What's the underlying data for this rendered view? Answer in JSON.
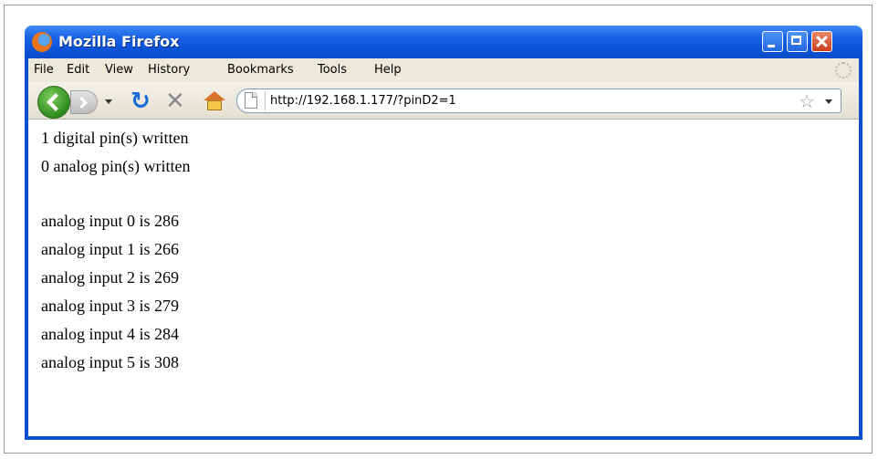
{
  "window": {
    "title": "Mozilla Firefox"
  },
  "menubar": {
    "items": [
      {
        "label": "File"
      },
      {
        "label": "Edit"
      },
      {
        "label": "View"
      },
      {
        "label": "History"
      },
      {
        "label": "Bookmarks"
      },
      {
        "label": "Tools"
      },
      {
        "label": "Help"
      }
    ]
  },
  "navbar": {
    "url": "http://192.168.1.177/?pinD2=1",
    "icons": [
      "back-icon",
      "forward-icon",
      "reload-icon",
      "stop-icon",
      "home-icon",
      "page-icon",
      "bookmark-star-icon"
    ]
  },
  "page": {
    "lines": [
      "1 digital pin(s) written",
      "0 analog pin(s) written",
      "analog input 0 is 286",
      "analog input 1 is 266",
      "analog input 2 is 269",
      "analog input 3 is 279",
      "analog input 4 is 284",
      "analog input 5 is 308"
    ]
  },
  "colors": {
    "titlebar": "#0a54d8",
    "menubar": "#ece9d8",
    "back_button": "#3b9b28"
  }
}
